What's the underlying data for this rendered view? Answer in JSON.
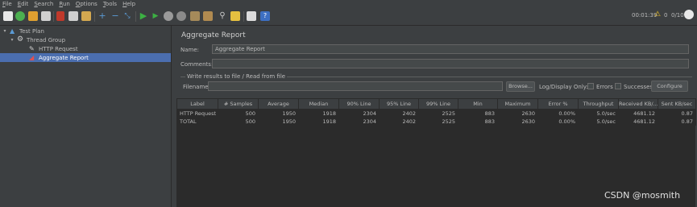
{
  "menu": {
    "items": [
      {
        "key": "F",
        "rest": "ile"
      },
      {
        "key": "E",
        "rest": "dit"
      },
      {
        "key": "S",
        "rest": "earch"
      },
      {
        "key": "R",
        "rest": "un"
      },
      {
        "key": "O",
        "rest": "ptions"
      },
      {
        "key": "T",
        "rest": "ools"
      },
      {
        "key": "H",
        "rest": "elp"
      }
    ]
  },
  "toolbar": {
    "elapsed": "00:01:39",
    "warning_count": "0",
    "threads": "0/10"
  },
  "tree": {
    "items": [
      {
        "label": "Test Plan",
        "icon": "flask-icon"
      },
      {
        "label": "Thread Group",
        "icon": "gear-icon"
      },
      {
        "label": "HTTP Request",
        "icon": "pipette-icon"
      },
      {
        "label": "Aggregate Report",
        "icon": "chart-icon"
      }
    ]
  },
  "panel": {
    "title": "Aggregate Report",
    "name_label": "Name:",
    "name_value": "Aggregate Report",
    "comments_label": "Comments:",
    "comments_value": "",
    "group_title": "Write results to file / Read from file",
    "filename_label": "Filename",
    "filename_value": "",
    "browse_label": "Browse...",
    "log_display_label": "Log/Display Only:",
    "errors_label": "Errors",
    "successes_label": "Successes",
    "configure_label": "Configure"
  },
  "table": {
    "headers": [
      "Label",
      "# Samples",
      "Average",
      "Median",
      "90% Line",
      "95% Line",
      "99% Line",
      "Min",
      "Maximum",
      "Error %",
      "Throughput",
      "Received KB/...",
      "Sent KB/sec"
    ],
    "rows": [
      [
        "HTTP Request",
        "500",
        "1950",
        "1918",
        "2304",
        "2402",
        "2525",
        "883",
        "2630",
        "0.00%",
        "5.0/sec",
        "4681.12",
        "0.87"
      ],
      [
        "TOTAL",
        "500",
        "1950",
        "1918",
        "2304",
        "2402",
        "2525",
        "883",
        "2630",
        "0.00%",
        "5.0/sec",
        "4681.12",
        "0.87"
      ]
    ]
  },
  "watermark": "CSDN @mosmith",
  "colors": {
    "background": "#3c3f41",
    "selection": "#4b6eaf",
    "table_bg": "#2b2b2b"
  }
}
